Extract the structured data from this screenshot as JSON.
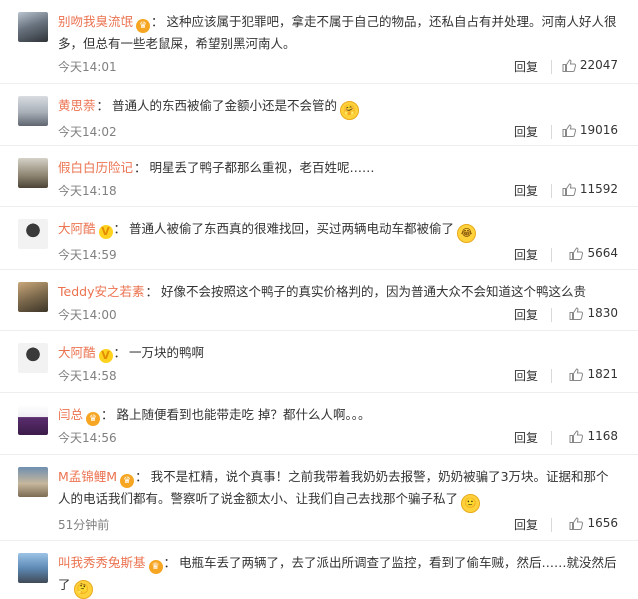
{
  "comments": [
    {
      "user": "别吻我臭流氓",
      "badge": "crown",
      "text": "这种应该属于犯罪吧，拿走不属于自己的物品，还私自占有并处理。河南人好人很多，但总有一些老鼠屎，希望别黑河南人。",
      "time": "今天14:01",
      "reply": "回复",
      "likes": "22047",
      "emoji": ""
    },
    {
      "user": "黄思萘",
      "badge": "",
      "text": "普通人的东西被偷了金额小还是不会管的",
      "time": "今天14:02",
      "reply": "回复",
      "likes": "19016",
      "emoji": "hug-emoji"
    },
    {
      "user": "假白白历险记",
      "badge": "",
      "text": "明星丢了鸭子都那么重视，老百姓呢……",
      "time": "今天14:18",
      "reply": "回复",
      "likes": "11592",
      "emoji": ""
    },
    {
      "user": "大阿酷",
      "badge": "vip",
      "text": "普通人被偷了东西真的很难找回，买过两辆电动车都被偷了",
      "time": "今天14:59",
      "reply": "回复",
      "likes": "5664",
      "emoji": "crying-emoji"
    },
    {
      "user": "Teddy安之若素",
      "badge": "",
      "text": "好像不会按照这个鸭子的真实价格判的，因为普通大众不会知道这个鸭这么贵",
      "time": "今天14:00",
      "reply": "回复",
      "likes": "1830",
      "emoji": ""
    },
    {
      "user": "大阿酷",
      "badge": "vip",
      "text": "一万块的鸭啊",
      "time": "今天14:58",
      "reply": "回复",
      "likes": "1821",
      "emoji": ""
    },
    {
      "user": "闫总",
      "badge": "crown",
      "text": "路上随便看到也能带走吃 掉？都什么人啊。。。",
      "time": "今天14:56",
      "reply": "回复",
      "likes": "1168",
      "emoji": ""
    },
    {
      "user": "M孟锦鲤M",
      "badge": "crown",
      "text": "我不是杠精，说个真事！之前我带着我奶奶去报警，奶奶被骗了3万块。证据和那个人的电话我们都有。警察听了说金额太小、让我们自己去找那个骗子私了",
      "time": "51分钟前",
      "reply": "回复",
      "likes": "1656",
      "emoji": "smile-emoji"
    },
    {
      "user": "叫我秀秀兔斯基",
      "badge": "crown",
      "text": "电瓶车丢了两辆了，去了派出所调查了监控，看到了偷车贼，然后……就没然后了",
      "time": "",
      "reply": "",
      "likes": "",
      "emoji": "thinking-emoji"
    }
  ]
}
